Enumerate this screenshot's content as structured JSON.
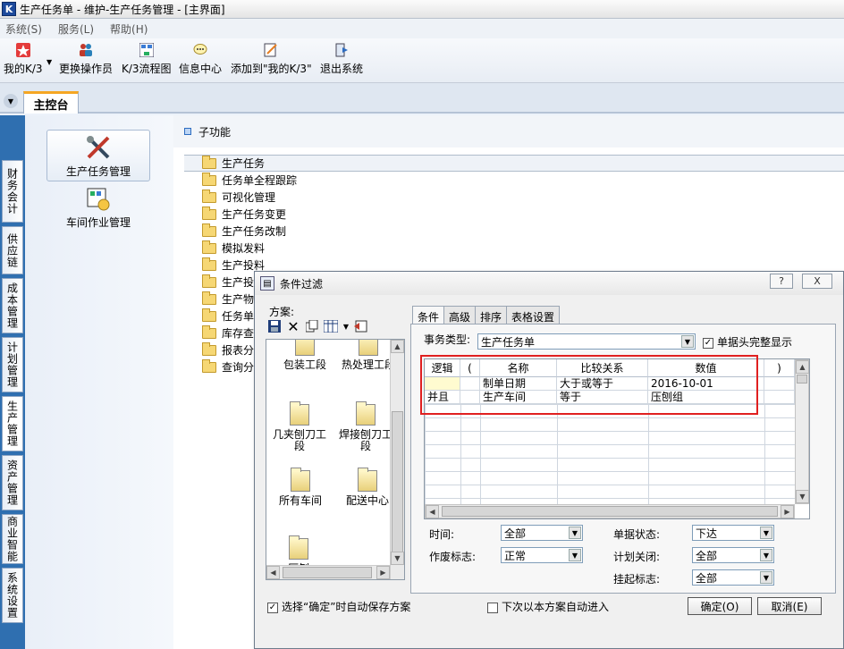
{
  "window": {
    "title": "生产任务单 - 维护-生产任务管理 - [主界面]",
    "app_icon": "K"
  },
  "menu": [
    "系统(S)",
    "服务(L)",
    "帮助(H)"
  ],
  "toolbar": {
    "my_k3": "我的K/3",
    "change_user": "更换操作员",
    "flowchart": "K/3流程图",
    "info_center": "信息中心",
    "add_to_my_k3": "添加到\"我的K/3\"",
    "exit": "退出系统"
  },
  "tabs": {
    "main": "主控台"
  },
  "vtabs": [
    "财务会计",
    "供应链",
    "成本管理",
    "计划管理",
    "生产管理",
    "资产管理",
    "商业智能",
    "系统设置"
  ],
  "modules": {
    "production_task": "生产任务管理",
    "workshop": "车间作业管理"
  },
  "subfunc": {
    "header": "子功能",
    "items": [
      "生产任务",
      "任务单全程跟踪",
      "可视化管理",
      "生产任务变更",
      "生产任务改制",
      "模拟发料",
      "生产投料",
      "生产投",
      "生产物",
      "任务单",
      "库存查",
      "报表分",
      "查询分"
    ]
  },
  "dialog": {
    "title": "条件过滤",
    "help_btn": "?",
    "close_btn": "X",
    "scheme_label": "方案:",
    "schemes": [
      "包装工段",
      "热处理工段",
      "几夹刨刀工段",
      "焊接刨刀工段",
      "所有车间",
      "配送中心",
      "压刨"
    ],
    "tabs": [
      "条件",
      "高级",
      "排序",
      "表格设置"
    ],
    "business_type_label": "事务类型:",
    "business_type_value": "生产任务单",
    "full_header_label": "单据头完整显示",
    "grid": {
      "headers": [
        "逻辑",
        "(",
        "名称",
        "比较关系",
        "数值",
        ")"
      ],
      "rows": [
        [
          "",
          "",
          "制单日期",
          "大于或等于",
          "2016-10-01",
          ""
        ],
        [
          "并且",
          "",
          "生产车间",
          "等于",
          "压刨组",
          ""
        ]
      ]
    },
    "time_label": "时间:",
    "time_value": "全部",
    "void_label": "作废标志:",
    "void_value": "正常",
    "doc_status_label": "单据状态:",
    "doc_status_value": "下达",
    "plan_close_label": "计划关闭:",
    "plan_close_value": "全部",
    "suspend_label": "挂起标志:",
    "suspend_value": "全部",
    "auto_save_label": "选择“确定”时自动保存方案",
    "auto_enter_label": "下次以本方案自动进入",
    "ok": "确定(O)",
    "cancel": "取消(E)"
  },
  "colors": {
    "accent": "#2f6fb0",
    "highlight": "#e02020",
    "tab_accent": "#f5a623"
  }
}
